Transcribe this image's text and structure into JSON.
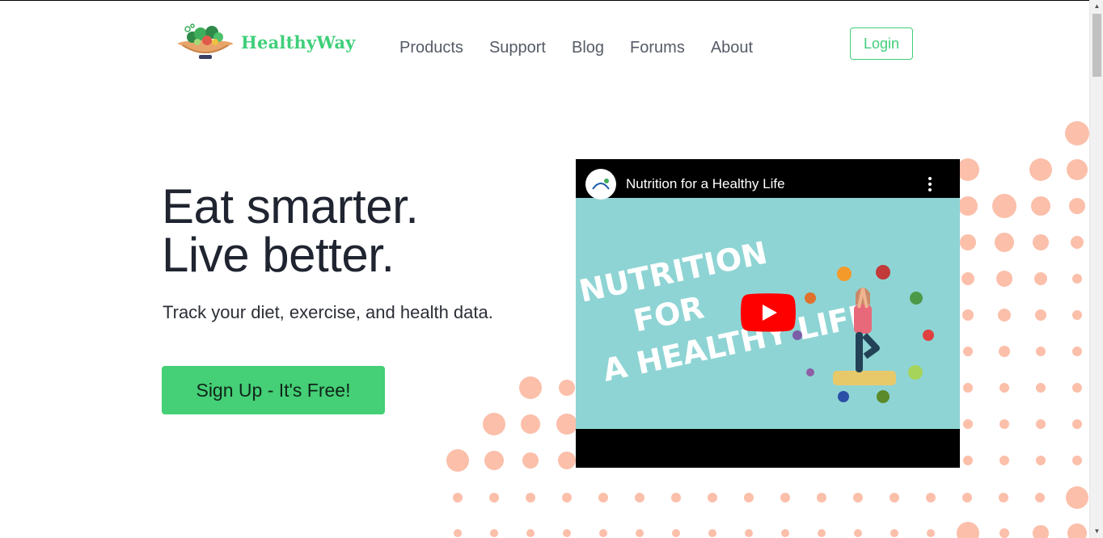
{
  "brand": {
    "name": "HealthyWay",
    "color": "#3fcf7a",
    "logo_icon": "salad-bowl-icon"
  },
  "nav": {
    "items": [
      {
        "label": "Products"
      },
      {
        "label": "Support"
      },
      {
        "label": "Blog"
      },
      {
        "label": "Forums"
      },
      {
        "label": "About"
      }
    ]
  },
  "login": {
    "label": "Login"
  },
  "hero": {
    "title_line1": "Eat smarter.",
    "title_line2": "Live better.",
    "subtitle": "Track your diet, exercise, and health data.",
    "cta_label": "Sign Up - It's Free!",
    "cta_color": "#45cf76"
  },
  "video": {
    "title": "Nutrition for a Healthy Life",
    "thumbnail_text": "NUTRITION FOR A HEALTHY LIFE",
    "play_icon": "play-button-icon",
    "more_icon": "more-options-icon",
    "background": "#8fd4d4"
  },
  "decor": {
    "dot_color": "#fbbfaa"
  }
}
